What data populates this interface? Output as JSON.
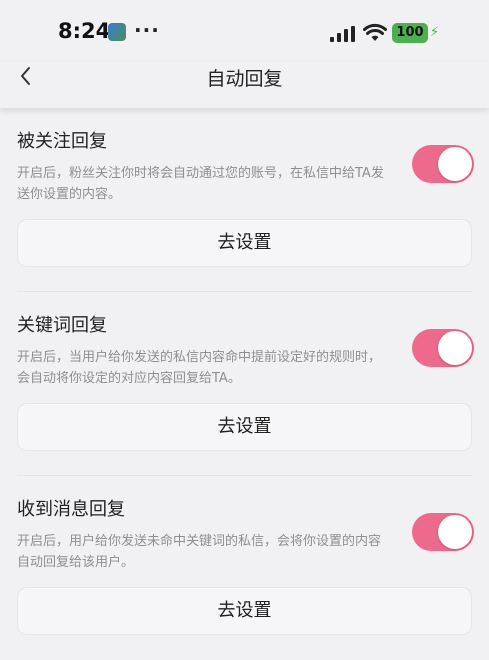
{
  "status_bar": {
    "time": "8:24",
    "dots": "···",
    "battery": "100",
    "battery_color": "#4caf50"
  },
  "nav": {
    "title": "自动回复",
    "back_icon": "chevron-left-icon"
  },
  "accent_color": "#ee6a8c",
  "sections": [
    {
      "title": "被关注回复",
      "description": "开启后，粉丝关注你时将会自动通过您的账号，在私信中给TA发送你设置的内容。",
      "enabled": true,
      "button_label": "去设置"
    },
    {
      "title": "关键词回复",
      "description": "开启后，当用户给你发送的私信内容命中提前设定好的规则时，会自动将你设定的对应内容回复给TA。",
      "enabled": true,
      "button_label": "去设置"
    },
    {
      "title": "收到消息回复",
      "description": "开启后，用户给你发送未命中关键词的私信，会将你设置的内容自动回复给该用户。",
      "enabled": true,
      "button_label": "去设置"
    }
  ]
}
